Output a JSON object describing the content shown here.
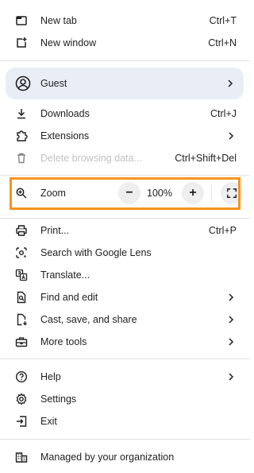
{
  "menu": {
    "new_tab": {
      "label": "New tab",
      "shortcut": "Ctrl+T",
      "icon": "new-tab-icon"
    },
    "new_window": {
      "label": "New window",
      "shortcut": "Ctrl+N",
      "icon": "new-window-icon"
    },
    "profile": {
      "label": "Guest",
      "icon": "account-circle-icon"
    },
    "downloads": {
      "label": "Downloads",
      "shortcut": "Ctrl+J",
      "icon": "download-icon"
    },
    "extensions": {
      "label": "Extensions",
      "icon": "puzzle-icon"
    },
    "delete_data": {
      "label": "Delete browsing data...",
      "shortcut": "Ctrl+Shift+Del",
      "icon": "trash-icon"
    },
    "zoom": {
      "label": "Zoom",
      "value": "100%",
      "decrease": "−",
      "increase": "+",
      "icon": "zoom-icon",
      "highlight_color": "#f7941d"
    },
    "print": {
      "label": "Print...",
      "shortcut": "Ctrl+P",
      "icon": "printer-icon"
    },
    "lens": {
      "label": "Search with Google Lens",
      "icon": "lens-icon"
    },
    "translate": {
      "label": "Translate...",
      "icon": "translate-icon"
    },
    "find_edit": {
      "label": "Find and edit",
      "icon": "find-page-icon"
    },
    "cast_save": {
      "label": "Cast, save, and share",
      "icon": "cast-save-icon"
    },
    "more_tools": {
      "label": "More tools",
      "icon": "toolbox-icon"
    },
    "help": {
      "label": "Help",
      "icon": "help-icon"
    },
    "settings": {
      "label": "Settings",
      "icon": "gear-icon"
    },
    "exit": {
      "label": "Exit",
      "icon": "exit-icon"
    },
    "managed": {
      "label": "Managed by your organization",
      "icon": "building-icon"
    }
  },
  "colors": {
    "profile_bg": "#e9eef6",
    "separator": "#e3e3e3",
    "zoom_highlight": "#f7941d"
  }
}
